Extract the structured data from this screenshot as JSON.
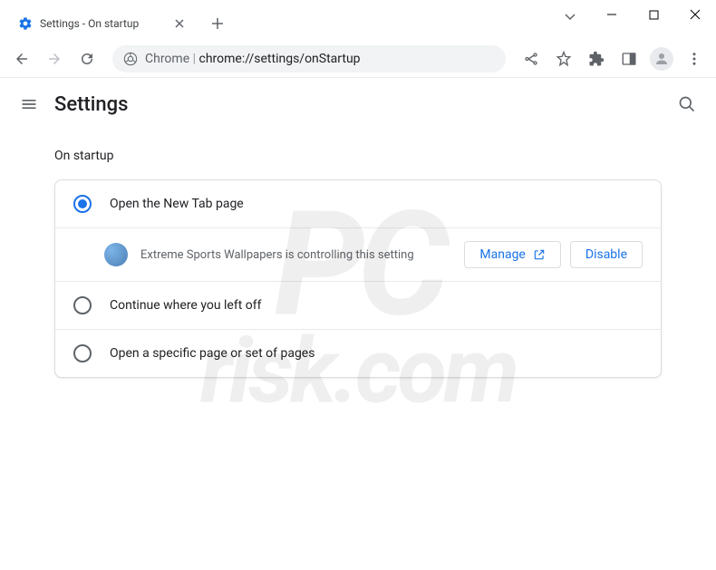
{
  "titlebar": {
    "tab_title": "Settings - On startup"
  },
  "omnibox": {
    "prefix": "Chrome",
    "url": "chrome://settings/onStartup"
  },
  "header": {
    "title": "Settings"
  },
  "startup": {
    "section_title": "On startup",
    "options": [
      {
        "label": "Open the New Tab page",
        "selected": true
      },
      {
        "label": "Continue where you left off",
        "selected": false
      },
      {
        "label": "Open a specific page or set of pages",
        "selected": false
      }
    ],
    "notice_text": "Extreme Sports Wallpapers is controlling this setting",
    "manage_label": "Manage",
    "disable_label": "Disable"
  },
  "watermark": {
    "line1": "PC",
    "line2": "risk.com"
  }
}
